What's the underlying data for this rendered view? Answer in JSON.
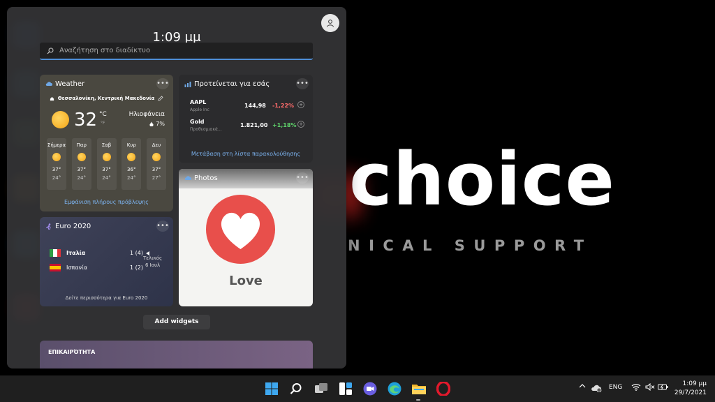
{
  "wallpaper": {
    "logo_text": "choice",
    "subtitle_text": "NICAL SUPPORT"
  },
  "panel": {
    "time": "1:09 μμ",
    "search_placeholder": "Αναζήτηση στο διαδίκτυο"
  },
  "weather": {
    "title": "Weather",
    "location": "Θεσσαλονίκη, Κεντρική Μακεδονία",
    "temperature": "32",
    "unit_c": "°C",
    "unit_f": "°F",
    "condition": "Ηλιοφάνεια",
    "precipitation": "7%",
    "forecast": [
      {
        "day": "Σήμερα",
        "high": "37°",
        "low": "24°"
      },
      {
        "day": "Παρ",
        "high": "37°",
        "low": "24°"
      },
      {
        "day": "Σαβ",
        "high": "37°",
        "low": "24°"
      },
      {
        "day": "Κυρ",
        "high": "36°",
        "low": "24°"
      },
      {
        "day": "Δευ",
        "high": "37°",
        "low": "27°"
      }
    ],
    "link": "Εμφάνιση πλήρους πρόβλεψης"
  },
  "stocks": {
    "title": "Προτείνεται για εσάς",
    "items": [
      {
        "symbol": "AAPL",
        "name": "Apple Inc",
        "price": "144,98",
        "change": "-1,22%",
        "change_color": "#ff6b6b"
      },
      {
        "symbol": "Gold",
        "name": "Προθεσμιακά...",
        "price": "1.821,00",
        "change": "+1,18%",
        "change_color": "#5fd36b"
      }
    ],
    "link": "Μετάβαση στη λίστα παρακολούθησης"
  },
  "photos": {
    "title": "Photos",
    "caption": "Love"
  },
  "euro": {
    "title": "Euro 2020",
    "teams": [
      {
        "name": "Ιταλία",
        "score": "1 (4)"
      },
      {
        "name": "Ισπανία",
        "score": "1 (2)"
      }
    ],
    "status_line1": "Τελικός",
    "status_line2": "6 Ιουλ",
    "link": "Δείτε περισσότερα για Euro 2020"
  },
  "add_widgets_label": "Add widgets",
  "news": {
    "title": "ΕΠΙΚΑΙΡΌΤΗΤΑ"
  },
  "taskbar": {
    "language": "ENG",
    "time": "1:09 μμ",
    "date": "29/7/2021"
  },
  "colors": {
    "accent": "#4f8fd7",
    "link": "#7cb3ef"
  }
}
